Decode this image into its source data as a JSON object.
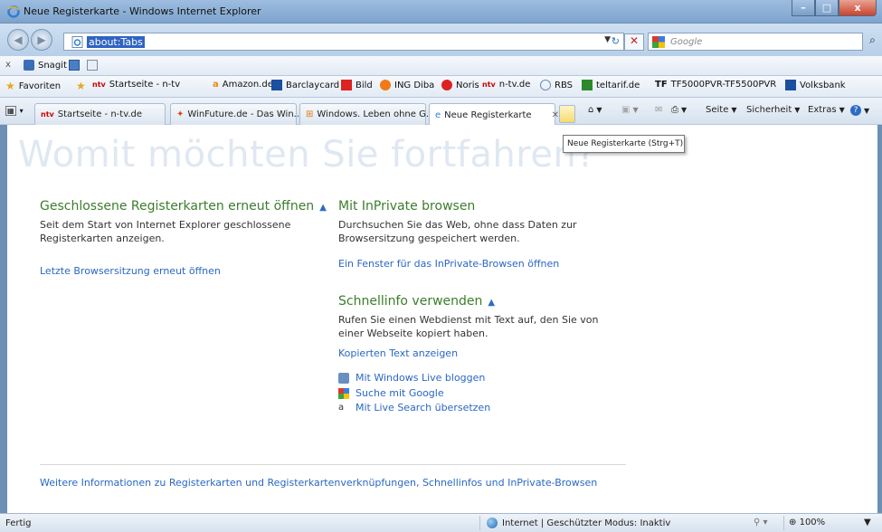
{
  "window": {
    "title": "Neue Registerkarte - Windows Internet Explorer",
    "buttons": {
      "minimize": "–",
      "maximize": "□",
      "close": "x"
    }
  },
  "address_bar": {
    "url": "about:Tabs",
    "search_placeholder": "Google",
    "search_provider_icon": "google-icon"
  },
  "snagit_toolbar": {
    "close": "x",
    "snagit_label": "Snagit"
  },
  "favorites_bar": {
    "favorites_label": "Favoriten",
    "items": [
      {
        "label": "Startseite - n-tv",
        "icon": "ntv-icon"
      },
      {
        "label": "Amazon.de",
        "icon": "amazon-icon"
      },
      {
        "label": "Barclaycard",
        "icon": "barclaycard-icon"
      },
      {
        "label": "Bild",
        "icon": "bild-icon"
      },
      {
        "label": "ING Diba",
        "icon": "ing-icon"
      },
      {
        "label": "Noris",
        "icon": "noris-icon"
      },
      {
        "label": "n-tv.de",
        "icon": "ntv-icon"
      },
      {
        "label": "RBS",
        "icon": "ie-page-icon"
      },
      {
        "label": "teltarif.de",
        "icon": "teltarif-icon"
      },
      {
        "label": "TF5000PVR-TF5500PVR",
        "icon": "tf-icon"
      },
      {
        "label": "Volksbank",
        "icon": "volksbank-icon"
      }
    ]
  },
  "tabs": [
    {
      "label": "Startseite - n-tv.de",
      "active": false
    },
    {
      "label": "WinFuture.de - Das Win...",
      "active": false
    },
    {
      "label": "Windows. Leben ohne G...",
      "active": false
    },
    {
      "label": "Neue Registerkarte",
      "active": true
    }
  ],
  "command_bar": {
    "seite": "Seite",
    "sicherheit": "Sicherheit",
    "extras": "Extras"
  },
  "tooltip": "Neue Registerkarte (Strg+T)",
  "content": {
    "heading": "Womit möchten Sie fortfahren?",
    "closed_tabs": {
      "title": "Geschlossene Registerkarten erneut öffnen",
      "text": "Seit dem Start von Internet Explorer geschlossene Registerkarten anzeigen.",
      "link": "Letzte Browsersitzung erneut öffnen"
    },
    "inprivate": {
      "title": "Mit InPrivate browsen",
      "text": "Durchsuchen Sie das Web, ohne dass Daten zur Browsersitzung gespeichert werden.",
      "link": "Ein Fenster für das InPrivate-Browsen öffnen"
    },
    "accelerators": {
      "title": "Schnellinfo verwenden",
      "text": "Rufen Sie einen Webdienst mit Text auf, den Sie von einer Webseite kopiert haben.",
      "link_show": "Kopierten Text anzeigen",
      "items": [
        {
          "label": "Mit Windows Live bloggen",
          "icon": "windows-live-icon"
        },
        {
          "label": "Suche mit Google",
          "icon": "google-icon"
        },
        {
          "label": "Mit Live Search übersetzen",
          "icon": "translate-icon"
        }
      ]
    },
    "footer_link": "Weitere Informationen zu Registerkarten und Registerkartenverknüpfungen, Schnellinfos und InPrivate-Browsen"
  },
  "status_bar": {
    "left": "Fertig",
    "zone": "Internet | Geschützter Modus: Inaktiv",
    "zoom": "100%"
  }
}
